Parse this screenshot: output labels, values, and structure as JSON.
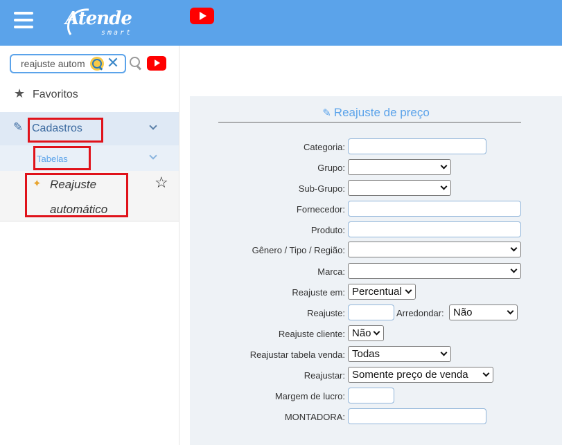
{
  "header": {
    "logo_text": "Atende",
    "logo_sub": "smart",
    "menu_icon": "hamburger-icon",
    "youtube_icon": "youtube-icon"
  },
  "sidebar": {
    "search_value": "reajuste autom",
    "favorites_label": "Favoritos",
    "menu": {
      "cadastros_label": "Cadastros",
      "tabelas_label": "Tabelas",
      "reajuste_line1": "Reajuste",
      "reajuste_line2": "automático"
    }
  },
  "form": {
    "title": "Reajuste de preço",
    "fields": {
      "categoria": "Categoria:",
      "grupo": "Grupo:",
      "subgrupo": "Sub-Grupo:",
      "fornecedor": "Fornecedor:",
      "produto": "Produto:",
      "genero": "Gênero / Tipo / Região:",
      "marca": "Marca:",
      "reajuste_em": "Reajuste em:",
      "reajuste_em_value": "Percentual",
      "reajuste": "Reajuste:",
      "arredondar": "Arredondar:",
      "arredondar_value": "Não",
      "reajuste_cliente": "Reajuste cliente:",
      "reajuste_cliente_value": "Não",
      "reajustar_tabela_venda": "Reajustar tabela venda:",
      "reajustar_tabela_venda_value": "Todas",
      "reajustar": "Reajustar:",
      "reajustar_value": "Somente preço de venda",
      "margem_lucro": "Margem de lucro:",
      "montadora": "MONTADORA:"
    }
  },
  "colors": {
    "header_bg": "#5ba3ea",
    "accent": "#5ba3ea",
    "highlight": "#e0121a",
    "panel_bg": "#eef2f6"
  }
}
